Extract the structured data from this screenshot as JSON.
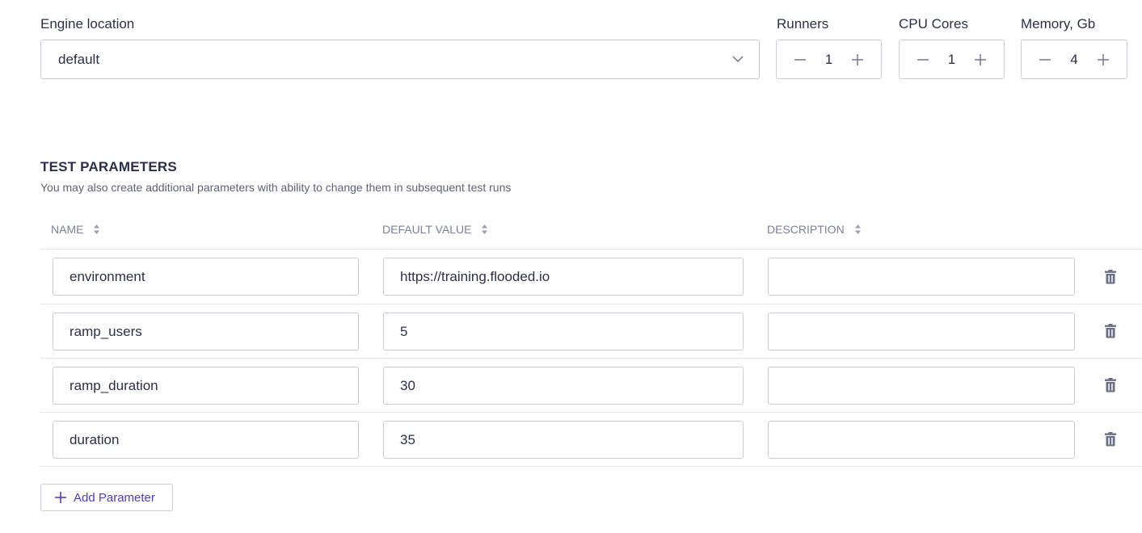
{
  "engine": {
    "label": "Engine location",
    "value": "default"
  },
  "runners": {
    "label": "Runners",
    "value": "1"
  },
  "cpu": {
    "label": "CPU Cores",
    "value": "1"
  },
  "memory": {
    "label": "Memory, Gb",
    "value": "4"
  },
  "test_parameters": {
    "title": "TEST PARAMETERS",
    "subtitle": "You may also create additional parameters with ability to change them in subsequent test runs",
    "columns": {
      "name": "NAME",
      "default_value": "DEFAULT VALUE",
      "description": "DESCRIPTION"
    },
    "rows": [
      {
        "name": "environment",
        "default_value": "https://training.flooded.io",
        "description": ""
      },
      {
        "name": "ramp_users",
        "default_value": "5",
        "description": ""
      },
      {
        "name": "ramp_duration",
        "default_value": "30",
        "description": ""
      },
      {
        "name": "duration",
        "default_value": "35",
        "description": ""
      }
    ],
    "add_label": "Add Parameter"
  },
  "icons": {
    "dropdown": "chevron-down-icon",
    "decrement": "minus-icon",
    "increment": "plus-icon",
    "sort": "sort-icon",
    "delete": "trash-icon",
    "add": "plus-icon"
  },
  "colors": {
    "text": "#2c2f4a",
    "muted": "#7b7f98",
    "border": "#c9cbd6",
    "accent": "#4b3fb8",
    "icon": "#6b6f88"
  }
}
